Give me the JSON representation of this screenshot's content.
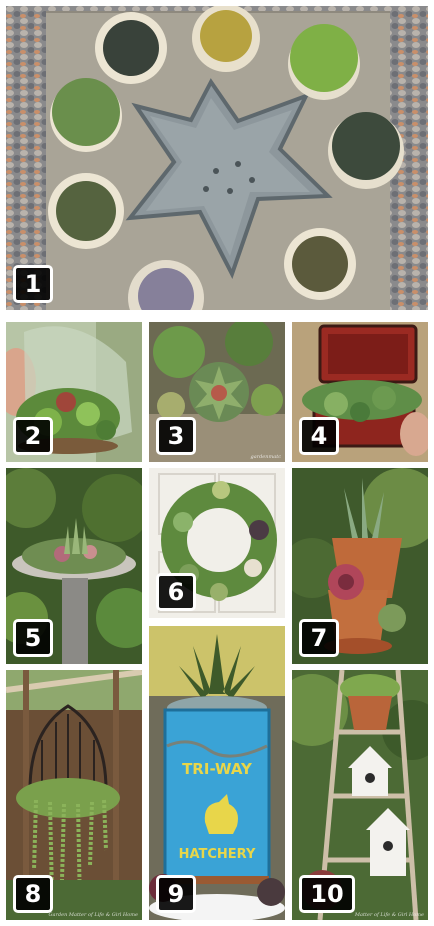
{
  "photos": [
    {
      "number": "1"
    },
    {
      "number": "2"
    },
    {
      "number": "3",
      "watermark": "gardenmatc"
    },
    {
      "number": "4"
    },
    {
      "number": "5"
    },
    {
      "number": "6"
    },
    {
      "number": "7"
    },
    {
      "number": "8",
      "credit": "Garden Matter of Life & Girl Home"
    },
    {
      "number": "9",
      "can_text_top": "TRI-WAY",
      "can_text_bottom": "HATCHERY"
    },
    {
      "number": "10",
      "credit": "Matter of Life & Girl Home"
    }
  ],
  "colors": {
    "badge_bg": "#000000",
    "badge_text": "#ffffff",
    "background": "#ffffff"
  }
}
